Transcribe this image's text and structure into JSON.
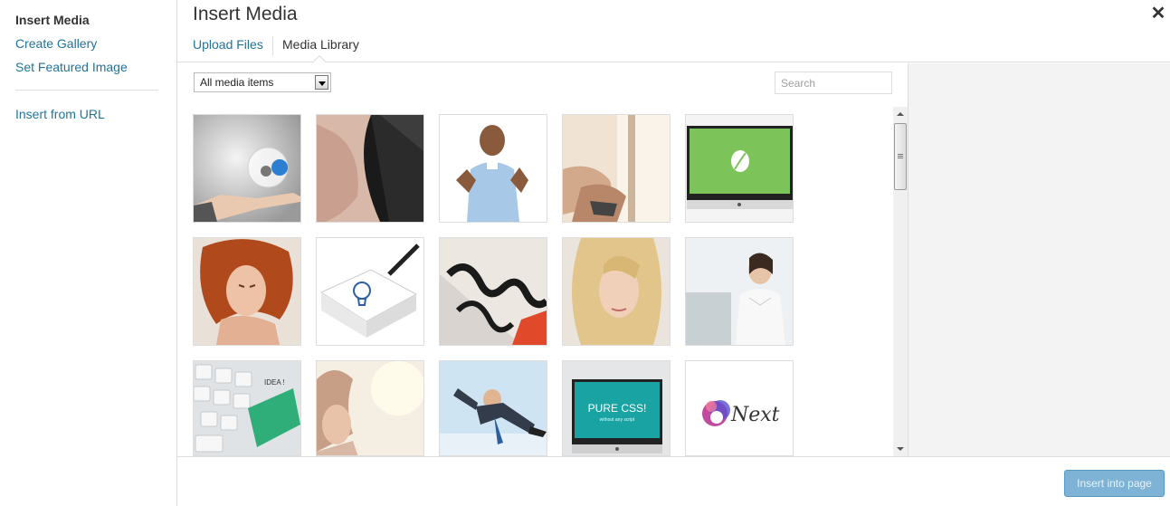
{
  "sidebar": {
    "items": [
      {
        "label": "Insert Media"
      },
      {
        "label": "Create Gallery"
      },
      {
        "label": "Set Featured Image"
      },
      {
        "label": "Insert from URL"
      }
    ]
  },
  "frame": {
    "title": "Insert Media",
    "close_icon": "close-icon"
  },
  "router": {
    "upload_label": "Upload Files",
    "library_label": "Media Library"
  },
  "toolbar_top": {
    "filter_selected": "All media items",
    "search_placeholder": "Search"
  },
  "footer": {
    "insert_label": "Insert into page"
  },
  "thumbnails": [
    {
      "subject": "lightbulb-in-hand"
    },
    {
      "subject": "woman-dark-hair-portrait"
    },
    {
      "subject": "man-thumbs-up"
    },
    {
      "subject": "woman-by-window"
    },
    {
      "subject": "imac-green-leaf"
    },
    {
      "subject": "woman-red-hair"
    },
    {
      "subject": "lightbulb-sketch-notepad"
    },
    {
      "subject": "typography-print"
    },
    {
      "subject": "blonde-woman-portrait"
    },
    {
      "subject": "businesswoman-office"
    },
    {
      "subject": "keyboard-green-key"
    },
    {
      "subject": "woman-soft-light"
    },
    {
      "subject": "businessman-flying"
    },
    {
      "subject": "imac-pure-css"
    },
    {
      "subject": "next-logo"
    }
  ],
  "thumb_texts": {
    "idea_key": "IDEA !",
    "pure_css": "PURE CSS!",
    "pure_css_sub": "without any script",
    "next_logo": "Next"
  }
}
